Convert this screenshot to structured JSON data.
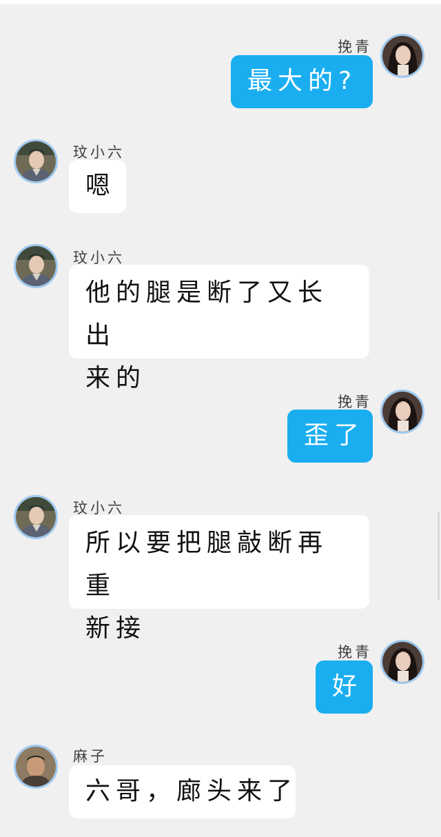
{
  "chat": {
    "messages": [
      {
        "sender": "挽青",
        "text": "最大的?",
        "outgoing": true,
        "avatar": "woman-portrait-avatar"
      },
      {
        "sender": "玟小六",
        "text": "嗯",
        "outgoing": false,
        "avatar": "xiaoliu-portrait-avatar"
      },
      {
        "sender": "玟小六",
        "lines": [
          "他的腿是断了又长出",
          "来的"
        ],
        "outgoing": false,
        "avatar": "xiaoliu-portrait-avatar"
      },
      {
        "sender": "挽青",
        "text": "歪了",
        "outgoing": true,
        "avatar": "woman-portrait-avatar"
      },
      {
        "sender": "玟小六",
        "lines": [
          "所以要把腿敲断再重",
          "新接"
        ],
        "outgoing": false,
        "avatar": "xiaoliu-portrait-avatar"
      },
      {
        "sender": "挽青",
        "text": "好",
        "outgoing": true,
        "avatar": "woman-portrait-avatar"
      },
      {
        "sender": "麻子",
        "text": "六哥，廊头来了",
        "outgoing": false,
        "avatar": "mazi-portrait-avatar"
      }
    ]
  },
  "colors": {
    "background": "#f0f0f0",
    "outgoing_bubble": "#1aaef0",
    "incoming_bubble": "#ffffff",
    "avatar_ring": "#9ec9ef"
  }
}
